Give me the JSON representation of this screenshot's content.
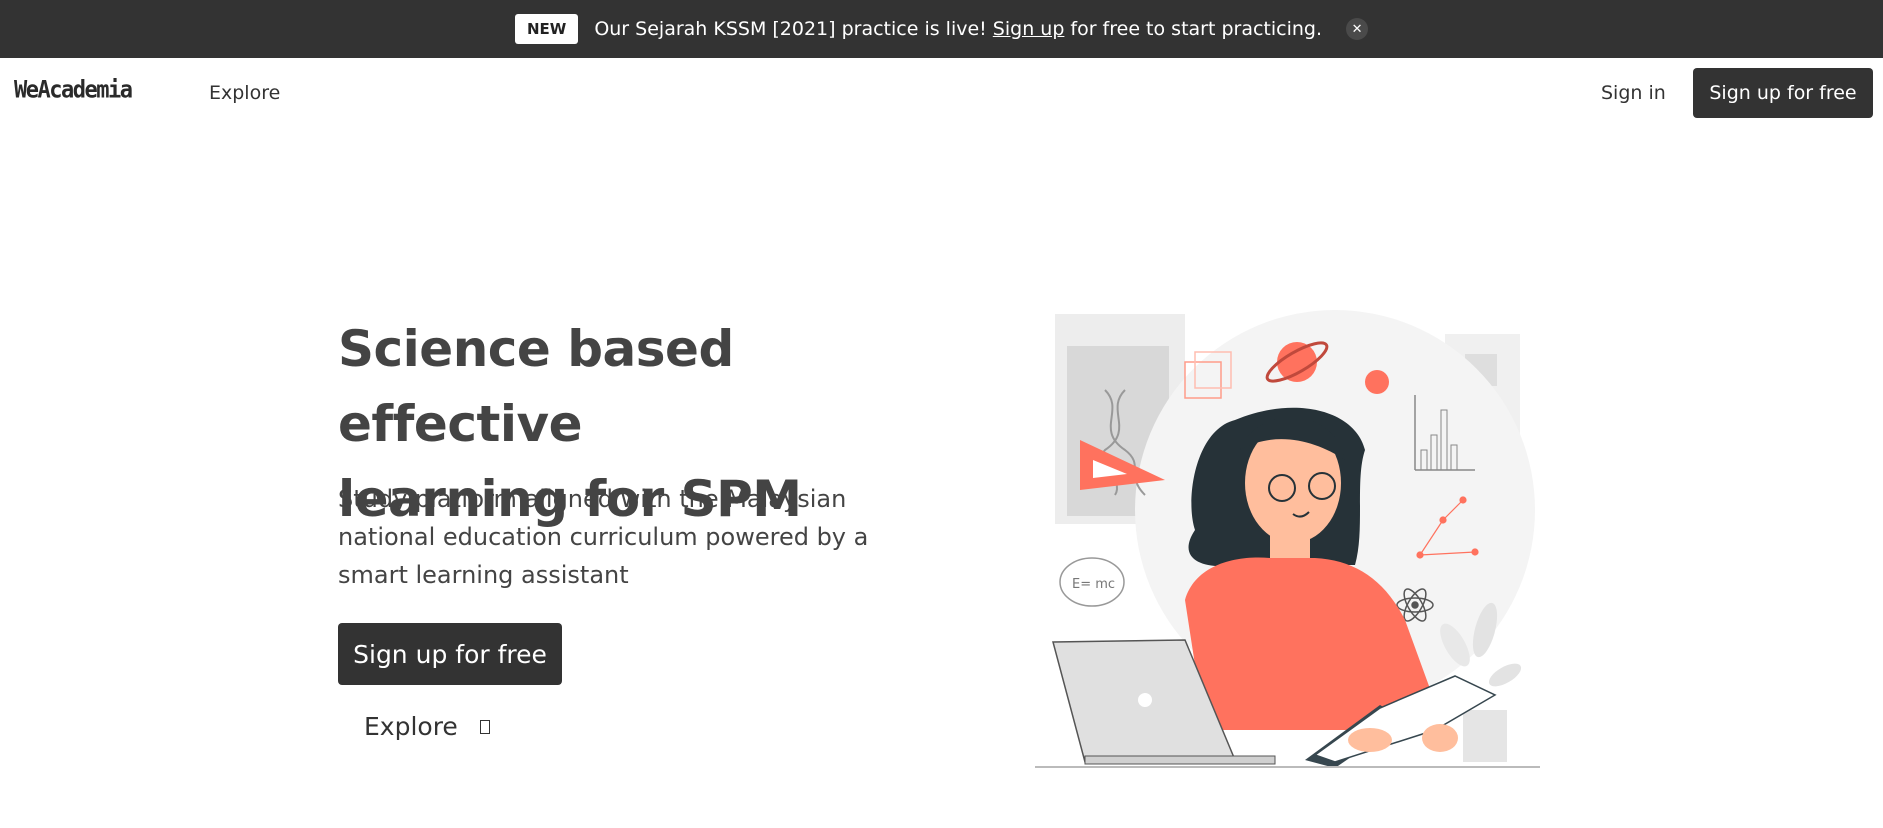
{
  "announcement": {
    "badge": "NEW",
    "text_before": "Our Sejarah KSSM [2021] practice is live!",
    "link": "Sign up",
    "text_after": "for free to start practicing.",
    "close_glyph": "✕"
  },
  "nav": {
    "logo": "WeAcademia",
    "explore": "Explore",
    "sign_in": "Sign in",
    "sign_up": "Sign up for free"
  },
  "hero": {
    "title_line1": "Science based effective",
    "title_line2": "learning for SPM",
    "subtitle": "Study platform aligned with the Malaysian national education curriculum powered by a smart learning assistant",
    "cta": "Sign up for free",
    "explore": "Explore"
  },
  "illustration": {
    "formula": "E= mc"
  },
  "colors": {
    "dark": "#333333",
    "accent": "#ff725e",
    "text": "#444444"
  }
}
